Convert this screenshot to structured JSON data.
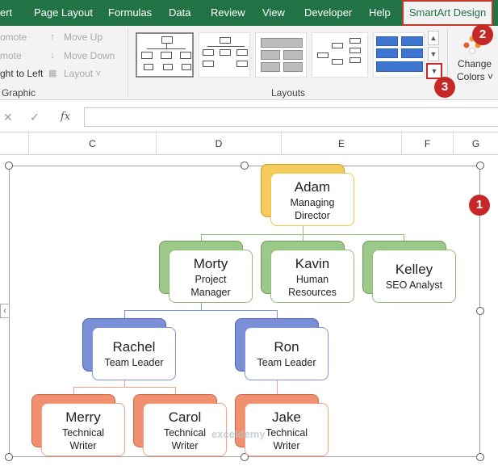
{
  "ribbon": {
    "tabs": [
      {
        "label": "ert"
      },
      {
        "label": "Page Layout"
      },
      {
        "label": "Formulas"
      },
      {
        "label": "Data"
      },
      {
        "label": "Review"
      },
      {
        "label": "View"
      },
      {
        "label": "Developer"
      },
      {
        "label": "Help"
      },
      {
        "label": "SmartArt Design"
      }
    ],
    "create_graphic": {
      "promote": "omote",
      "demote": "mote",
      "right_to_left": "ght to Left",
      "move_up": "Move Up",
      "move_down": "Move Down",
      "layout": "Layout",
      "group_label": "Graphic"
    },
    "layouts_group_label": "Layouts",
    "change_colors": {
      "line1": "Change",
      "line2": "Colors"
    }
  },
  "badges": {
    "b1": "1",
    "b2": "2",
    "b3": "3"
  },
  "formula_bar": {
    "fx": "fx",
    "value": ""
  },
  "columns": [
    "C",
    "D",
    "E",
    "F",
    "G"
  ],
  "org_chart": {
    "adam": {
      "name": "Adam",
      "title1": "Managing",
      "title2": "Director"
    },
    "morty": {
      "name": "Morty",
      "title1": "Project",
      "title2": "Manager"
    },
    "kavin": {
      "name": "Kavin",
      "title1": "Human",
      "title2": "Resources"
    },
    "kelley": {
      "name": "Kelley",
      "title1": "SEO Analyst"
    },
    "rachel": {
      "name": "Rachel",
      "title1": "Team Leader"
    },
    "ron": {
      "name": "Ron",
      "title1": "Team Leader"
    },
    "merry": {
      "name": "Merry",
      "title1": "Technical",
      "title2": "Writer"
    },
    "carol": {
      "name": "Carol",
      "title1": "Technical",
      "title2": "Writer"
    },
    "jake": {
      "name": "Jake",
      "title1": "Technical",
      "title2": "Writer"
    }
  },
  "watermark": "exceldemy",
  "colors": {
    "ribbon_green": "#217346",
    "badge_red": "#c62828",
    "yellow": "#f5cb5c",
    "green": "#9cc98a",
    "blue": "#7a8fd6",
    "orange": "#f0906e"
  }
}
